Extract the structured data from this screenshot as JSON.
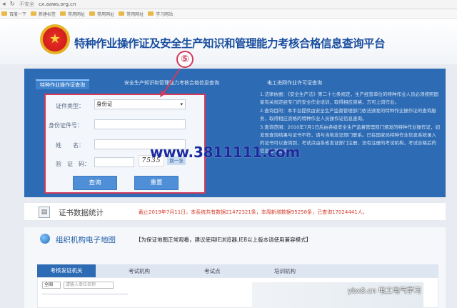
{
  "browser": {
    "security_label": "不安全",
    "url": "cx.aaws.org.cn",
    "bookmarks": [
      {
        "label": "百度一下"
      },
      {
        "label": "新建标签"
      },
      {
        "label": "常用网址"
      },
      {
        "label": "常用网址"
      },
      {
        "label": "常用网址"
      },
      {
        "label": "学习网站"
      }
    ]
  },
  "header": {
    "site_title": "特种作业操作证及安全生产知识和管理能力考核合格信息查询平台"
  },
  "tabs": [
    {
      "label": "特种作业操作证查询"
    },
    {
      "label": "安全生产知识和管理能力考核合格信息查询"
    },
    {
      "label": "电工进网作业许可证查询"
    }
  ],
  "form": {
    "id_type_label": "证件类型：",
    "id_type_value": "身份证",
    "id_number_label": "身份证件号：",
    "name_label": "姓　　名：",
    "captcha_label": "验　证　码：",
    "captcha_text": "7535",
    "refresh_label": "换一张",
    "query_button": "查询",
    "reset_button": "重置"
  },
  "callout": {
    "label": "⑤"
  },
  "notes": [
    "1.法律依据：《安全生产法》第二十七条规定，生产经营单位的特种作业人员必须按照国家有关规定经专门的安全作业培训，取得相应资格，方可上岗作业。",
    "2.查询目的：本平台提供由安全生产监督管理部门依法颁发的特种作业操作证的查询服务，取得相应资格的特种作业人员操作证信息查询。",
    "3.查询范围：2010年7月1日后由各级安全生产监督管理部门颁发的特种作业操作证，如发现查询结果与证书不符，请与当地发证部门联系。已在国家局特种作业信息系统录入的证书可以查询到，考试点由各省发证部门注册，没有注册的考试机构，考试合格后的信息也可查询。"
  ],
  "watermark": {
    "url_text": "www.3811111.com",
    "credit_text": "ybx8.cn 电工电气学习"
  },
  "stats": {
    "title": "证书数据统计",
    "text": "截止2019年7月11日，本系统共有数据21472321条，本周新增数据95258条，已查询17024441人。"
  },
  "map": {
    "title": "组织机构电子地图",
    "note": "【为保证地图正常观看，建议使用IE浏览器,IE8以上版本请使用兼容模式】",
    "tabs": [
      {
        "label": "考核发证机关"
      },
      {
        "label": "考试机构"
      },
      {
        "label": "考试点"
      },
      {
        "label": "培训机构"
      }
    ],
    "region_value": "全国",
    "unit_placeholder": "请输入单位名称"
  }
}
